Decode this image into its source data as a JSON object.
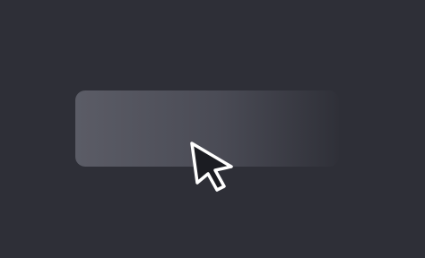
{
  "colors": {
    "background": "#2e2f37",
    "bar_left": "#5b5c66",
    "bar_mid": "#4a4b55",
    "bar_right": "#2f3038",
    "cursor_fill": "#1b1c22",
    "cursor_stroke": "#ffffff"
  },
  "icons": {
    "cursor": "arrow-pointer"
  }
}
